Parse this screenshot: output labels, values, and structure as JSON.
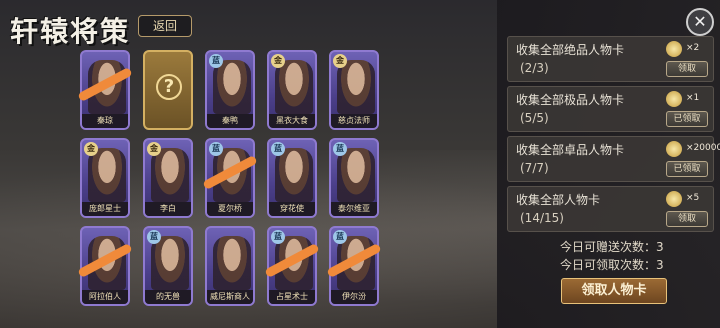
{
  "title": "轩辕将策",
  "back_label": "返回",
  "cards": [
    {
      "name": "秦琼",
      "badge": "",
      "scribble": true
    },
    {
      "name": "",
      "badge": "",
      "unknown": true,
      "unknown_label": "?"
    },
    {
      "name": "秦鸭",
      "badge": "蓝",
      "scribble": false
    },
    {
      "name": "黑衣大食",
      "badge": "金",
      "scribble": false
    },
    {
      "name": "慈贞法师",
      "badge": "金",
      "scribble": false
    },
    {
      "name": "庞郎星士",
      "badge": "金",
      "scribble": false
    },
    {
      "name": "李白",
      "badge": "金",
      "scribble": false
    },
    {
      "name": "夏尔桥",
      "badge": "蓝",
      "scribble": true
    },
    {
      "name": "穿花使",
      "badge": "蓝",
      "scribble": false
    },
    {
      "name": "泰尔维亚",
      "badge": "蓝",
      "scribble": false
    },
    {
      "name": "阿拉伯人",
      "badge": "",
      "scribble": true
    },
    {
      "name": "的无兽",
      "badge": "蓝",
      "scribble": false
    },
    {
      "name": "威尼斯商人",
      "badge": "",
      "scribble": false
    },
    {
      "name": "占星术士",
      "badge": "蓝",
      "scribble": true
    },
    {
      "name": "伊尔汾",
      "badge": "蓝",
      "scribble": true
    }
  ],
  "tasks": [
    {
      "title": "收集全部绝品人物卡",
      "progress": "(2/3)",
      "reward_count": "×2",
      "button": "领取"
    },
    {
      "title": "收集全部极品人物卡",
      "progress": "(5/5)",
      "reward_count": "×1",
      "button": "已领取"
    },
    {
      "title": "收集全部卓品人物卡",
      "progress": "(7/7)",
      "reward_count": "×20000",
      "button": "已领取"
    },
    {
      "title": "收集全部人物卡",
      "progress": "(14/15)",
      "reward_count": "×5",
      "button": "领取"
    }
  ],
  "gift_count_label": "今日可赠送次数：3",
  "claim_count_label": "今日可领取次数：3",
  "claim_button": "领取人物卡",
  "close_label": "✕"
}
